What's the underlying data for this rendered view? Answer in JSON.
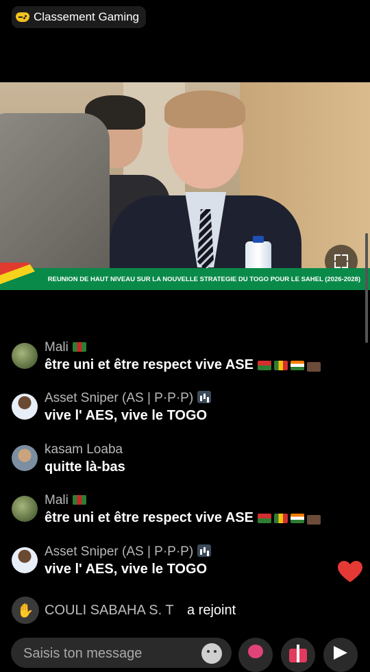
{
  "header": {
    "badge_label": "Classement Gaming",
    "badge_icon": "gamepad-icon"
  },
  "video": {
    "banner_text": "REUNION DE HAUT NIVEAU SUR LA NOUVELLE STRATEGIE DU TOGO POUR LE SAHEL (2026-2028)",
    "fullscreen_icon": "fullscreen-icon",
    "banner_color": "#0a8a49"
  },
  "messages": [
    {
      "name": "Mali",
      "text": "être uni et être respect vive ASE",
      "avatar": "landscape-avatar",
      "badge": "flag"
    },
    {
      "name": "Asset Sniper (AS | P·P·P)",
      "text": "vive l' AES, vive le TOGO",
      "avatar": "boy-avatar",
      "badge": "chart"
    },
    {
      "name": "kasam Loaba",
      "text": "quitte là-bas",
      "avatar": "kasam-avatar",
      "badge": ""
    },
    {
      "name": "Mali",
      "text": "être uni et être respect vive ASE",
      "avatar": "landscape-avatar",
      "badge": "flag"
    },
    {
      "name": "Asset Sniper (AS | P·P·P)",
      "text": "vive l' AES, vive le TOGO",
      "avatar": "boy-avatar",
      "badge": "chart"
    }
  ],
  "join_notice": {
    "name": "COULI SABAHA  S. T",
    "action": "a rejoint"
  },
  "composer": {
    "placeholder": "Saisis ton message"
  },
  "colors": {
    "background": "#000000",
    "heart": "#e53935",
    "accent_green": "#0a8a49"
  }
}
